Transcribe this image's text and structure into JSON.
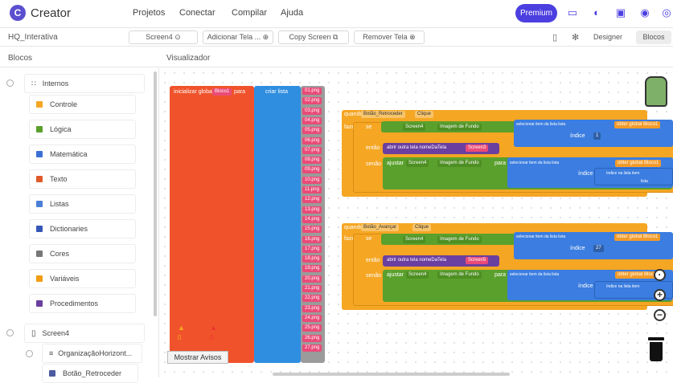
{
  "app": {
    "title": "Creator",
    "logo_letter": "C"
  },
  "menu": [
    "Projetos",
    "Conectar",
    "Compilar",
    "Ajuda"
  ],
  "premium_label": "Premium",
  "project_name": "HQ_Interativa",
  "screen_select": "Screen4",
  "toolbar": {
    "add_screen": "Adicionar Tela ...",
    "copy_screen": "Copy Screen",
    "remove_screen": "Remover Tela"
  },
  "views": {
    "designer": "Designer",
    "blocks": "Blocos"
  },
  "panels": {
    "blocks": "Blocos",
    "viewer": "Visualizador"
  },
  "sidebar": {
    "builtin": "Internos",
    "items": [
      {
        "label": "Controle",
        "color": "#f5a623"
      },
      {
        "label": "Lógica",
        "color": "#5aa02c"
      },
      {
        "label": "Matemática",
        "color": "#3b6fd6"
      },
      {
        "label": "Texto",
        "color": "#e05a2b"
      },
      {
        "label": "Listas",
        "color": "#4a7fd8"
      },
      {
        "label": "Dictionaries",
        "color": "#3557b7"
      },
      {
        "label": "Cores",
        "color": "#777777"
      },
      {
        "label": "Variáveis",
        "color": "#f39c12"
      },
      {
        "label": "Procedimentos",
        "color": "#6b3fa0"
      }
    ],
    "screen": "Screen4",
    "arrangement": "OrganizaçãoHorizont...",
    "child": "Botão_Retroceder"
  },
  "blocks": {
    "global_init": "inicializar global",
    "global_name": "Bloco1",
    "para": "para",
    "criar_lista": "criar lista",
    "images": [
      "01.png",
      "02.png",
      "03.png",
      "04.png",
      "05.png",
      "06.png",
      "07.png",
      "08.png",
      "09.png",
      "10.png",
      "11.png",
      "12.png",
      "13.png",
      "14.png",
      "15.png",
      "16.png",
      "17.png",
      "18.png",
      "19.png",
      "20.png",
      "21.png",
      "22.png",
      "23.png",
      "24.png",
      "25.png",
      "26.png",
      "27.png"
    ],
    "event1": {
      "quando": "quando",
      "component": "Botão_Retroceder",
      "event": "Clique"
    },
    "event2": {
      "quando": "quando",
      "component": "Botão_Avançar",
      "event": "Clique"
    },
    "fazer": "fazer",
    "se": "se",
    "entao": "então",
    "senao": "senão",
    "screen": "Screen4",
    "image_prop": "Imagem de Fundo",
    "select_item": "selecionar item da lista lista",
    "index": "índice",
    "get_global": "obter global Bloco1",
    "open_screen": "abrir outra tela nomeDaTela",
    "screen3": "Screen3",
    "screen5": "Screen5",
    "ajustar": "ajustar",
    "index_in_list": "índice na lista item",
    "lista": "lista",
    "num1": "1",
    "num27": "27"
  },
  "warnings": {
    "warn_count": "0",
    "error_count": "0"
  },
  "show_warnings": "Mostrar Avisos"
}
